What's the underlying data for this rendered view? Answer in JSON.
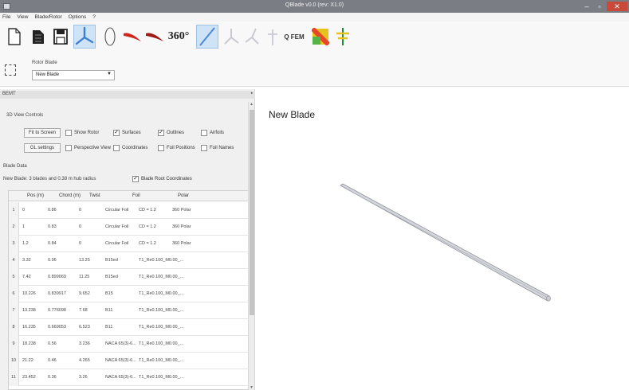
{
  "window": {
    "title": "QBlade v0.0 (rev: X1.0)",
    "min": "–",
    "max": "▫",
    "close": "✕"
  },
  "menu": [
    "File",
    "View",
    "Blade/Rotor",
    "Options",
    "?"
  ],
  "toolbar": {
    "buttons": [
      "new-file",
      "open-folder",
      "save",
      "rotor-blade-design",
      "airfoil-design",
      "blade-red",
      "blade-dark-red",
      "360-extrapolation",
      "bem-simulation",
      "multi-param-bem",
      "turbine-bem",
      "characteristic",
      "qfem",
      "bem-chart",
      "turbine-sim"
    ],
    "label_360": "360°",
    "label_qfem": "Q FEM"
  },
  "rotor": {
    "label": "Rotor Blade",
    "selected": "New Blade"
  },
  "dock": {
    "title": "BEMT",
    "view_controls_label": "3D View Controls",
    "fit_to_screen": "Fit to Screen",
    "gl_settings": "GL settings",
    "checkboxes": [
      {
        "label": "Show Rotor",
        "checked": false
      },
      {
        "label": "Surfaces",
        "checked": true
      },
      {
        "label": "Outlines",
        "checked": true
      },
      {
        "label": "Airfoils",
        "checked": false
      },
      {
        "label": "Perspective View",
        "checked": false
      },
      {
        "label": "Coordinates",
        "checked": false
      },
      {
        "label": "Foil Positions",
        "checked": false
      },
      {
        "label": "Foil Names",
        "checked": false
      }
    ],
    "blade_data_label": "Blade Data",
    "blade_info": "New Blade: 3 blades and 0.38 m hub radius",
    "root_coords": {
      "label": "Blade Root Coordinates",
      "checked": true
    }
  },
  "table": {
    "columns": [
      "Pos (m)",
      "Chord (m)",
      "Twist",
      "Foil",
      "Polar"
    ],
    "rows": [
      [
        "1",
        "0",
        "0.86",
        "0",
        "Circular Foil",
        "CD = 1.2",
        "360 Polar"
      ],
      [
        "2",
        "1",
        "0.83",
        "0",
        "Circular Foil",
        "CD = 1.2",
        "360 Polar"
      ],
      [
        "3",
        "1.2",
        "0.84",
        "0",
        "Circular Foil",
        "CD = 1.2",
        "360 Polar"
      ],
      [
        "4",
        "3.32",
        "0.96",
        "13.25",
        "B15ed",
        "T1_Re0.100_M0.00_..."
      ],
      [
        "5",
        "7.42",
        "0.899069",
        "11.25",
        "B15ed",
        "T1_Re0.100_M0.00_..."
      ],
      [
        "6",
        "10.226",
        "0.839917",
        "9.652",
        "B15",
        "T1_Re0.100_M0.00_..."
      ],
      [
        "7",
        "13.238",
        "0.776098",
        "7.68",
        "B11",
        "T1_Re0.100_M0.00_..."
      ],
      [
        "8",
        "16.235",
        "0.669053",
        "6.523",
        "B11",
        "T1_Re0.100_M0.00_..."
      ],
      [
        "9",
        "18.238",
        "0.56",
        "3.236",
        "NACA 65(3)-6...",
        "T1_Re0.100_M0.00_..."
      ],
      [
        "10",
        "21.22",
        "0.46",
        "4.265",
        "NACA 65(3)-6...",
        "T1_Re0.100_M0.00_..."
      ],
      [
        "11",
        "23.452",
        "0.36",
        "3.26",
        "NACA 65(3)-6...",
        "T1_Re0.100_M0.00_..."
      ]
    ]
  },
  "view": {
    "title": "New Blade"
  },
  "colors": {
    "active_button": "#cfe3f7",
    "close": "#c74a3b",
    "blade": "#c9ccd3"
  }
}
